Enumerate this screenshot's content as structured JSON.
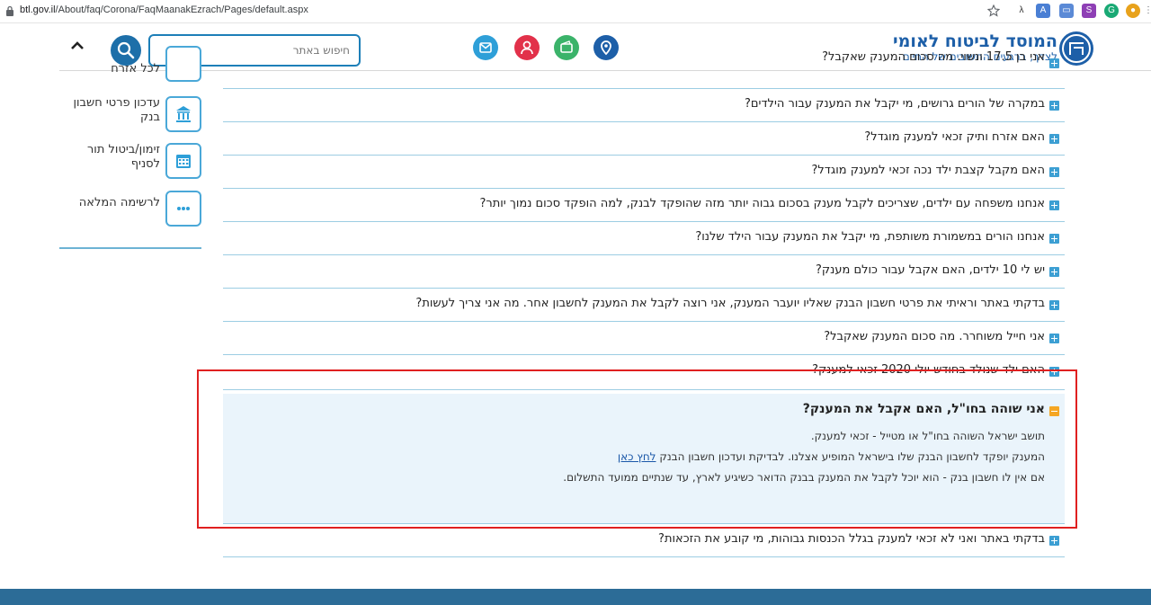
{
  "browser": {
    "url_host": "btl.gov.il",
    "url_path": "/About/faq/Corona/FaqMaanakEzrach/Pages/default.aspx"
  },
  "header": {
    "logo_title": "המוסד לביטוח לאומי",
    "logo_tagline": "לצדך, ברגעים החשובים של החיים",
    "search_placeholder": "חיפוש באתר",
    "colors": {
      "brand": "#1d5fa8",
      "mail": "#2e9fd8",
      "user": "#e2314a",
      "wallet": "#3bb36a",
      "location": "#1d5fa8"
    }
  },
  "sidebar": {
    "items": [
      {
        "label": "לכל אזרח",
        "icon": "partial-icon"
      },
      {
        "label": "עדכון פרטי חשבון בנק",
        "icon": "bank-icon"
      },
      {
        "label": "זימון/ביטול תור לסניף",
        "icon": "calendar-icon"
      },
      {
        "label": "לרשימה המלאה",
        "icon": "more-icon"
      }
    ]
  },
  "faq": {
    "partial_question": "אני בן 17.5 ונשוי. מה סכום המענק שאקבל?",
    "questions": [
      "במקרה של הורים גרושים, מי יקבל את המענק עבור הילדים?",
      "האם אזרח ותיק זכאי למענק מוגדל?",
      "האם מקבל קצבת ילד נכה זכאי למענק מוגדל?",
      "אנחנו משפחה עם ילדים, שצריכים לקבל מענק בסכום גבוה יותר מזה שהופקד לבנק, למה הופקד סכום נמוך יותר?",
      "אנחנו הורים במשמורת משותפת, מי יקבל את המענק עבור הילד שלנו?",
      "יש לי 10 ילדים, האם אקבל עבור כולם מענק?",
      "בדקתי באתר וראיתי את פרטי חשבון הבנק שאליו יועבר המענק, אני רוצה לקבל את המענק לחשבון אחר. מה אני צריך לעשות?",
      "אני חייל משוחרר. מה סכום המענק שאקבל?",
      "האם ילד שנולד בחודש יולי 2020 זכאי למענק?"
    ],
    "open_item": {
      "question": "אני שוהה בחו\"ל, האם אקבל את המענק?",
      "answer_line1": "תושב ישראל השוהה בחו\"ל או מטייל - זכאי למענק.",
      "answer_line2": "המענק יופקד לחשבון הבנק שלו בישראל המופיע אצלנו. לבדיקת ועדכון חשבון הבנק",
      "answer_link": "לחץ כאן",
      "answer_line3": "אם אין לו חשבון בנק - הוא יוכל לקבל את המענק בבנק הדואר כשיגיע לארץ, עד שנתיים ממועד התשלום."
    },
    "last_question": "בדקתי באתר ואני לא זכאי למענק בגלל הכנסות גבוהות, מי קובע את הזכאות?"
  }
}
